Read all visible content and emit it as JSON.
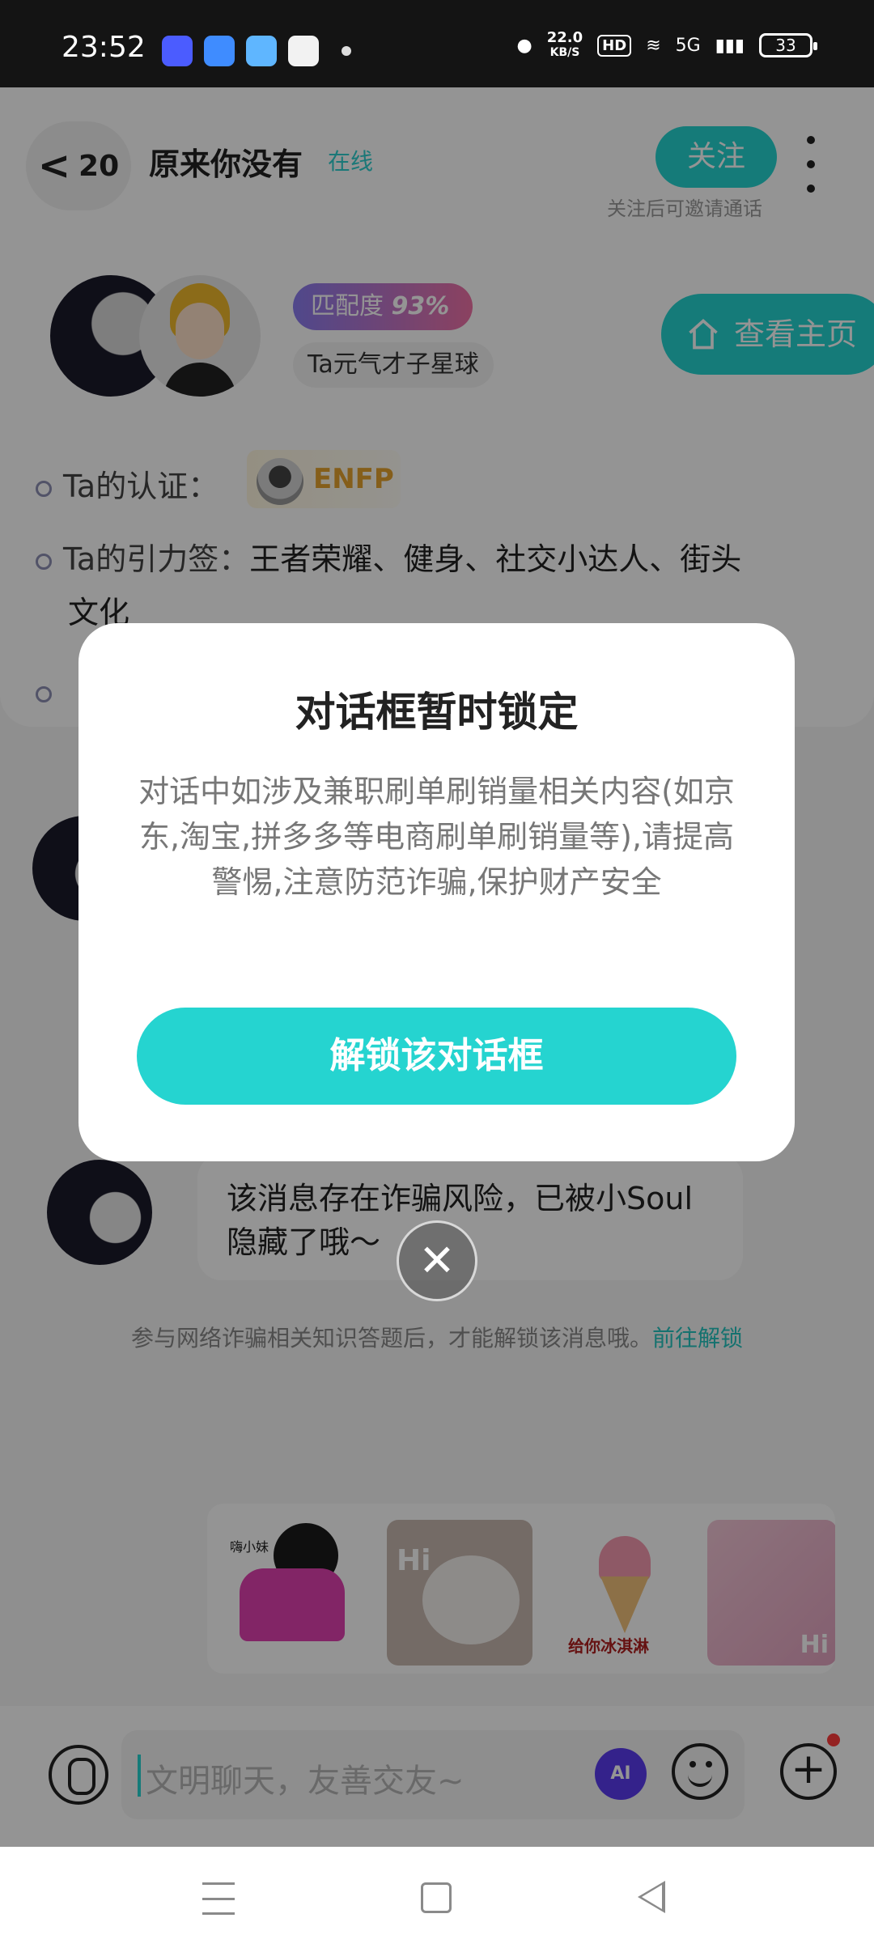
{
  "status_bar": {
    "time": "23:52",
    "speed_value": "22.0",
    "speed_unit": "KB/S",
    "hd": "HD",
    "network": "5G",
    "battery": "33"
  },
  "header": {
    "back_count": "20",
    "peer_name": "原来你没有",
    "online_status": "在线",
    "follow_label": "关注",
    "follow_hint": "关注后可邀请通话"
  },
  "profile": {
    "match_label": "匹配度",
    "match_value": "93%",
    "planet": "Ta元气才子星球",
    "home_button": "查看主页",
    "certification_label": "Ta的认证：",
    "certification_value": "ENFP",
    "tags_label": "Ta的引力签：",
    "tags_value": "王者荣耀、健身、社交小达人、街头",
    "tags_value_wrap": "文化"
  },
  "modal": {
    "title": "对话框暂时锁定",
    "message": "对话中如涉及兼职刷单刷销量相关内容(如京东,淘宝,拼多多等电商刷单刷销量等),请提高警惕,注意防范诈骗,保护财产安全",
    "unlock_button": "解锁该对话框",
    "close_glyph": "✕"
  },
  "chat": {
    "hidden_message": "该消息存在诈骗风险，已被小Soul隐藏了哦～",
    "unlock_tip": "参与网络诈骗相关知识答题后，才能解锁该消息哦。",
    "unlock_link": "前往解锁"
  },
  "stickers": {
    "sticker1_label": "嗨小妹",
    "sticker2_label": "Hi",
    "sticker3_label": "给你冰淇淋",
    "sticker4_label": "Hi"
  },
  "input": {
    "placeholder": "文明聊天，友善交友~",
    "ai_label": "AI"
  },
  "colors": {
    "accent": "#25d4d0",
    "link": "#25c4c0",
    "badge_start": "#8a7cf0",
    "badge_end": "#f072a6"
  },
  "icons": [
    "back-chevron-icon",
    "more-icon",
    "home-icon",
    "voice-icon",
    "ai-icon",
    "emoji-icon",
    "plus-icon",
    "close-icon",
    "nav-menu-icon",
    "nav-home-icon",
    "nav-back-icon"
  ]
}
